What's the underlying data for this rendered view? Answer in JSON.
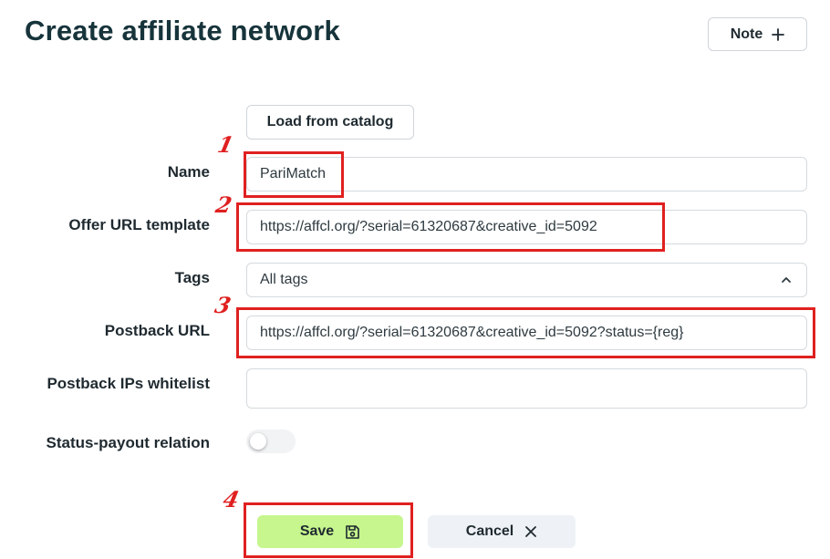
{
  "header": {
    "title": "Create affiliate network",
    "note_label": "Note"
  },
  "form": {
    "load_catalog_label": "Load from catalog",
    "name_label": "Name",
    "name_value": "PariMatch",
    "offer_url_label": "Offer URL template",
    "offer_url_value": "https://affcl.org/?serial=61320687&creative_id=5092",
    "tags_label": "Tags",
    "tags_value": "All tags",
    "postback_url_label": "Postback URL",
    "postback_url_value": "https://affcl.org/?serial=61320687&creative_id=5092?status={reg}",
    "postback_ips_label": "Postback IPs whitelist",
    "postback_ips_value": "",
    "status_payout_label": "Status-payout relation",
    "status_payout_enabled": false
  },
  "actions": {
    "save_label": "Save",
    "cancel_label": "Cancel"
  },
  "annotations": {
    "marker_1": "1",
    "marker_2": "2",
    "marker_3": "3",
    "marker_4": "4",
    "color": "#e02020"
  },
  "colors": {
    "save_bg": "#c6f68d",
    "cancel_bg": "#eef2f6",
    "title": "#17343b"
  },
  "icons": {
    "note": "plus-icon",
    "tags": "chevron-up-icon",
    "save": "floppy-disk-icon",
    "cancel": "close-icon"
  }
}
